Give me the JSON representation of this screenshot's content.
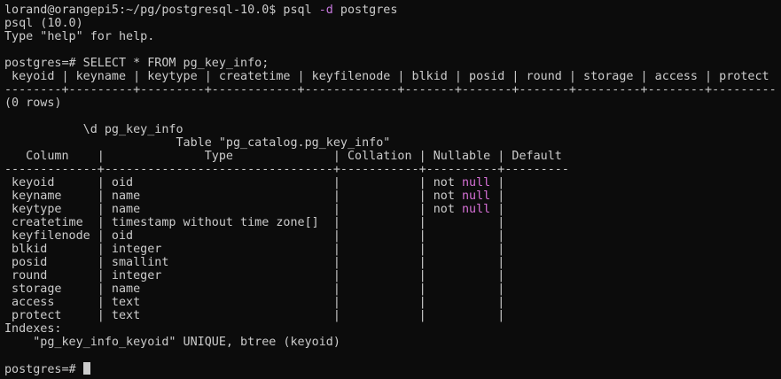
{
  "terminal": {
    "lines": [
      {
        "segments": [
          {
            "text": "lorand@orangepi5:~/pg/postgresql-10.0$ psql "
          },
          {
            "text": "-d",
            "style": "kw"
          },
          {
            "text": " postgres"
          }
        ]
      },
      {
        "segments": [
          {
            "text": "psql (10.0)"
          }
        ]
      },
      {
        "segments": [
          {
            "text": "Type \"help\" for help."
          }
        ]
      },
      {
        "segments": [
          {
            "text": ""
          }
        ]
      },
      {
        "segments": [
          {
            "text": "postgres=# SELECT * FROM pg_key_info;"
          }
        ]
      },
      {
        "segments": [
          {
            "text": " keyoid | keyname | keytype | createtime | keyfilenode | blkid | posid | round | storage | access | protect"
          }
        ]
      },
      {
        "segments": [
          {
            "text": "--------+---------+---------+------------+-------------+-------+-------+-------+---------+--------+---------"
          }
        ]
      },
      {
        "segments": [
          {
            "text": "(0 rows)"
          }
        ]
      },
      {
        "segments": [
          {
            "text": ""
          }
        ]
      },
      {
        "segments": [
          {
            "text": "           \\d pg_key_info"
          }
        ]
      },
      {
        "segments": [
          {
            "text": "                        Table \"pg_catalog.pg_key_info\""
          }
        ]
      },
      {
        "segments": [
          {
            "text": "   Column    |              Type              | Collation | Nullable | Default"
          }
        ]
      },
      {
        "segments": [
          {
            "text": "-------------+--------------------------------+-----------+----------+---------"
          }
        ]
      },
      {
        "segments": [
          {
            "text": " keyoid      | oid                            |           | not "
          },
          {
            "text": "null",
            "style": "null"
          },
          {
            "text": " |"
          }
        ]
      },
      {
        "segments": [
          {
            "text": " keyname     | name                           |           | not "
          },
          {
            "text": "null",
            "style": "null"
          },
          {
            "text": " |"
          }
        ]
      },
      {
        "segments": [
          {
            "text": " keytype     | name                           |           | not "
          },
          {
            "text": "null",
            "style": "null"
          },
          {
            "text": " |"
          }
        ]
      },
      {
        "segments": [
          {
            "text": " createtime  | timestamp without time zone[]  |           |          |"
          }
        ]
      },
      {
        "segments": [
          {
            "text": " keyfilenode | oid                            |           |          |"
          }
        ]
      },
      {
        "segments": [
          {
            "text": " blkid       | integer                        |           |          |"
          }
        ]
      },
      {
        "segments": [
          {
            "text": " posid       | smallint                       |           |          |"
          }
        ]
      },
      {
        "segments": [
          {
            "text": " round       | integer                        |           |          |"
          }
        ]
      },
      {
        "segments": [
          {
            "text": " storage     | name                           |           |          |"
          }
        ]
      },
      {
        "segments": [
          {
            "text": " access      | text                           |           |          |"
          }
        ]
      },
      {
        "segments": [
          {
            "text": " protect     | text                           |           |          |"
          }
        ]
      },
      {
        "segments": [
          {
            "text": "Indexes:"
          }
        ]
      },
      {
        "segments": [
          {
            "text": "    \"pg_key_info_keyoid\" UNIQUE, btree (keyoid)"
          }
        ]
      },
      {
        "segments": [
          {
            "text": ""
          }
        ]
      }
    ],
    "prompt": "postgres=# ",
    "colors": {
      "background": "#0c0c0c",
      "foreground": "#cccccc",
      "flag": "#c678dd",
      "null_keyword": "#d670d6"
    }
  }
}
